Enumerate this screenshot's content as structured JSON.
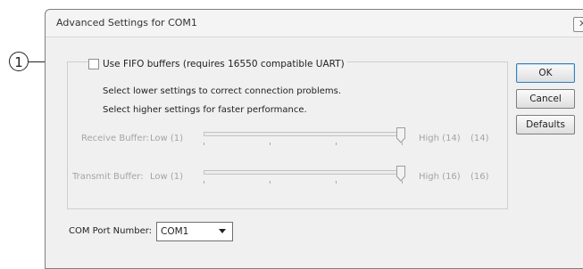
{
  "dialog": {
    "title": "Advanced Settings for COM1",
    "close_icon": "close-x-icon"
  },
  "fifo": {
    "checkbox_label": "Use FIFO buffers (requires 16550 compatible UART)",
    "checked": false
  },
  "hints": {
    "lower": "Select lower settings to correct connection problems.",
    "higher": "Select higher settings for faster performance."
  },
  "receive_buffer": {
    "label": "Receive Buffer:",
    "low": "Low (1)",
    "high": "High (14)",
    "value": "(14)",
    "slider_value": 14,
    "slider_max": 14,
    "enabled": false
  },
  "transmit_buffer": {
    "label": "Transmit Buffer:",
    "low": "Low (1)",
    "high": "High (16)",
    "value": "(16)",
    "slider_value": 16,
    "slider_max": 16,
    "enabled": false
  },
  "buttons": {
    "ok": "OK",
    "cancel": "Cancel",
    "defaults": "Defaults"
  },
  "com_port": {
    "label": "COM Port Number:",
    "selected": "COM1"
  },
  "callout": {
    "number": "1"
  },
  "colors": {
    "dialog_bg": "#f0f0f0",
    "disabled_text": "#a4a4a4",
    "default_button_border": "#3c7fb1"
  }
}
